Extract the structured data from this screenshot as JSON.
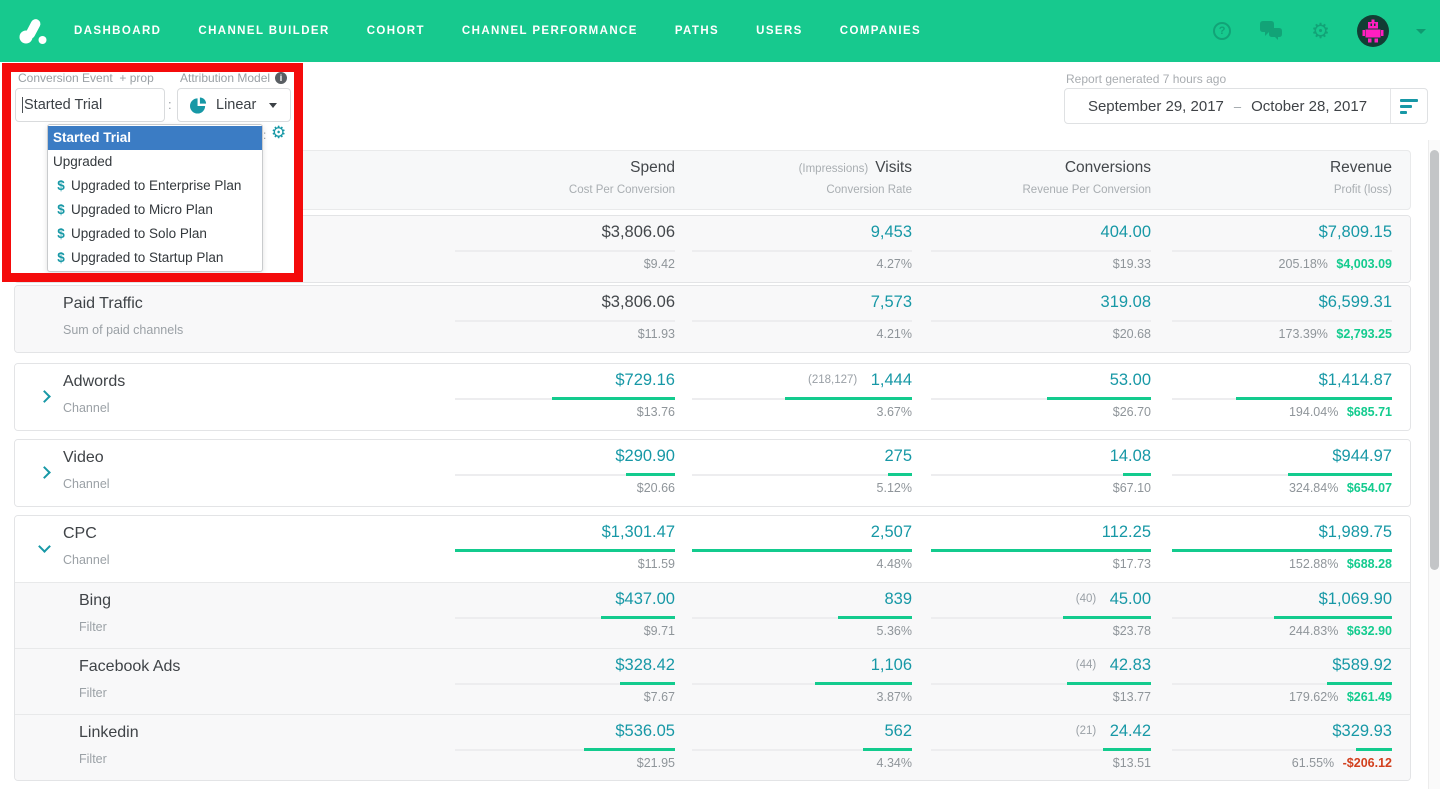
{
  "colors": {
    "brand_green": "#17c98e",
    "link_teal": "#1798a6",
    "profit_green": "#13cb8e",
    "loss_red": "#d2401e",
    "highlight_blue": "#3b7cc4",
    "annotation_red": "#f40b0b"
  },
  "nav": {
    "items": [
      {
        "label": "DASHBOARD"
      },
      {
        "label": "CHANNEL BUILDER"
      },
      {
        "label": "COHORT"
      },
      {
        "label": "CHANNEL PERFORMANCE"
      },
      {
        "label": "PATHS"
      },
      {
        "label": "USERS"
      },
      {
        "label": "COMPANIES"
      }
    ],
    "icons": {
      "help": "?",
      "chat": "chat-bubbles",
      "settings": "⚙",
      "avatar": "robot-avatar",
      "caret": "▾"
    }
  },
  "controls": {
    "conversion_label": "Conversion Event",
    "prop_label": "+ prop",
    "event_value": "Started Trial",
    "colon": ":",
    "attribution_label": "Attribution Model",
    "model_value": "Linear",
    "settings_glyph": "⚙"
  },
  "dropdown": {
    "money_symbol": "$",
    "options": [
      {
        "label": "Started Trial",
        "selected": true,
        "money": false
      },
      {
        "label": "Upgraded",
        "selected": false,
        "money": false
      },
      {
        "label": "Upgraded to Enterprise Plan",
        "selected": false,
        "money": true
      },
      {
        "label": "Upgraded to Micro Plan",
        "selected": false,
        "money": true
      },
      {
        "label": "Upgraded to Solo Plan",
        "selected": false,
        "money": true
      },
      {
        "label": "Upgraded to Startup Plan",
        "selected": false,
        "money": true
      }
    ]
  },
  "report": {
    "generated": "Report generated 7 hours ago",
    "date_start": "September 29, 2017",
    "date_separator": "–",
    "date_end": "October 28, 2017"
  },
  "table": {
    "columns": [
      {
        "pre": "",
        "title": "Spend",
        "subtitle": "Cost Per Conversion"
      },
      {
        "pre": "(Impressions)",
        "title": "Visits",
        "subtitle": "Conversion Rate"
      },
      {
        "pre": "",
        "title": "Conversions",
        "subtitle": "Revenue Per Conversion"
      },
      {
        "pre": "",
        "title": "Revenue",
        "subtitle": "Profit (loss)"
      }
    ],
    "rows": [
      {
        "card": 0,
        "shade": "gray",
        "title": "",
        "subtitle": "",
        "chevron": "none",
        "indent": false,
        "cells": [
          {
            "main": "$3,806.06",
            "sub": "$9.42",
            "dark": true,
            "bar": 0
          },
          {
            "main": "9,453",
            "sub": "4.27%",
            "bar": 0
          },
          {
            "main": "404.00",
            "sub": "$19.33",
            "bar": 0
          },
          {
            "main": "$7,809.15",
            "pct": "205.18%",
            "profit": "$4,003.09",
            "neg": false,
            "bar": 0
          }
        ]
      },
      {
        "card": 1,
        "shade": "gray",
        "title": "Paid Traffic",
        "subtitle": "Sum of paid channels",
        "chevron": "none",
        "indent": false,
        "cells": [
          {
            "main": "$3,806.06",
            "sub": "$11.93",
            "dark": true,
            "bar": 0
          },
          {
            "main": "7,573",
            "sub": "4.21%",
            "bar": 0
          },
          {
            "main": "319.08",
            "sub": "$20.68",
            "bar": 0
          },
          {
            "main": "$6,599.31",
            "pct": "173.39%",
            "profit": "$2,793.25",
            "neg": false,
            "bar": 0
          }
        ]
      },
      {
        "card": 2,
        "shade": "white",
        "title": "Adwords",
        "subtitle": "Channel",
        "chevron": "right",
        "indent": false,
        "cells": [
          {
            "main": "$729.16",
            "sub": "$13.76",
            "bar": 123
          },
          {
            "pre": "(218,127)",
            "main": "1,444",
            "sub": "3.67%",
            "bar": 127
          },
          {
            "main": "53.00",
            "sub": "$26.70",
            "bar": 104
          },
          {
            "main": "$1,414.87",
            "pct": "194.04%",
            "profit": "$685.71",
            "neg": false,
            "bar": 156
          }
        ]
      },
      {
        "card": 3,
        "shade": "white",
        "title": "Video",
        "subtitle": "Channel",
        "chevron": "right",
        "indent": false,
        "cells": [
          {
            "main": "$290.90",
            "sub": "$20.66",
            "bar": 49
          },
          {
            "main": "275",
            "sub": "5.12%",
            "bar": 24
          },
          {
            "main": "14.08",
            "sub": "$67.10",
            "bar": 28
          },
          {
            "main": "$944.97",
            "pct": "324.84%",
            "profit": "$654.07",
            "neg": false,
            "bar": 104
          }
        ]
      },
      {
        "card": 4,
        "shade": "white",
        "title": "CPC",
        "subtitle": "Channel",
        "chevron": "down",
        "indent": false,
        "cells": [
          {
            "main": "$1,301.47",
            "sub": "$11.59",
            "bar": 220
          },
          {
            "main": "2,507",
            "sub": "4.48%",
            "bar": 220
          },
          {
            "main": "112.25",
            "sub": "$17.73",
            "bar": 220
          },
          {
            "main": "$1,989.75",
            "pct": "152.88%",
            "profit": "$688.28",
            "neg": false,
            "bar": 220
          }
        ]
      },
      {
        "card": 4,
        "shade": "gray",
        "title": "Bing",
        "subtitle": "Filter",
        "chevron": "none",
        "indent": true,
        "cells": [
          {
            "main": "$437.00",
            "sub": "$9.71",
            "bar": 74
          },
          {
            "main": "839",
            "sub": "5.36%",
            "bar": 74
          },
          {
            "pre": "(40)",
            "main": "45.00",
            "sub": "$23.78",
            "bar": 88
          },
          {
            "main": "$1,069.90",
            "pct": "244.83%",
            "profit": "$632.90",
            "neg": false,
            "bar": 118
          }
        ]
      },
      {
        "card": 4,
        "shade": "gray",
        "title": "Facebook Ads",
        "subtitle": "Filter",
        "chevron": "none",
        "indent": true,
        "cells": [
          {
            "main": "$328.42",
            "sub": "$7.67",
            "bar": 55
          },
          {
            "main": "1,106",
            "sub": "3.87%",
            "bar": 97
          },
          {
            "pre": "(44)",
            "main": "42.83",
            "sub": "$13.77",
            "bar": 84
          },
          {
            "main": "$589.92",
            "pct": "179.62%",
            "profit": "$261.49",
            "neg": false,
            "bar": 65
          }
        ]
      },
      {
        "card": 4,
        "shade": "gray",
        "title": "Linkedin",
        "subtitle": "Filter",
        "chevron": "none",
        "indent": true,
        "cells": [
          {
            "main": "$536.05",
            "sub": "$21.95",
            "bar": 91
          },
          {
            "main": "562",
            "sub": "4.34%",
            "bar": 49
          },
          {
            "pre": "(21)",
            "main": "24.42",
            "sub": "$13.51",
            "bar": 48
          },
          {
            "main": "$329.93",
            "pct": "61.55%",
            "profit": "-$206.12",
            "neg": true,
            "bar": 36
          }
        ]
      }
    ]
  }
}
